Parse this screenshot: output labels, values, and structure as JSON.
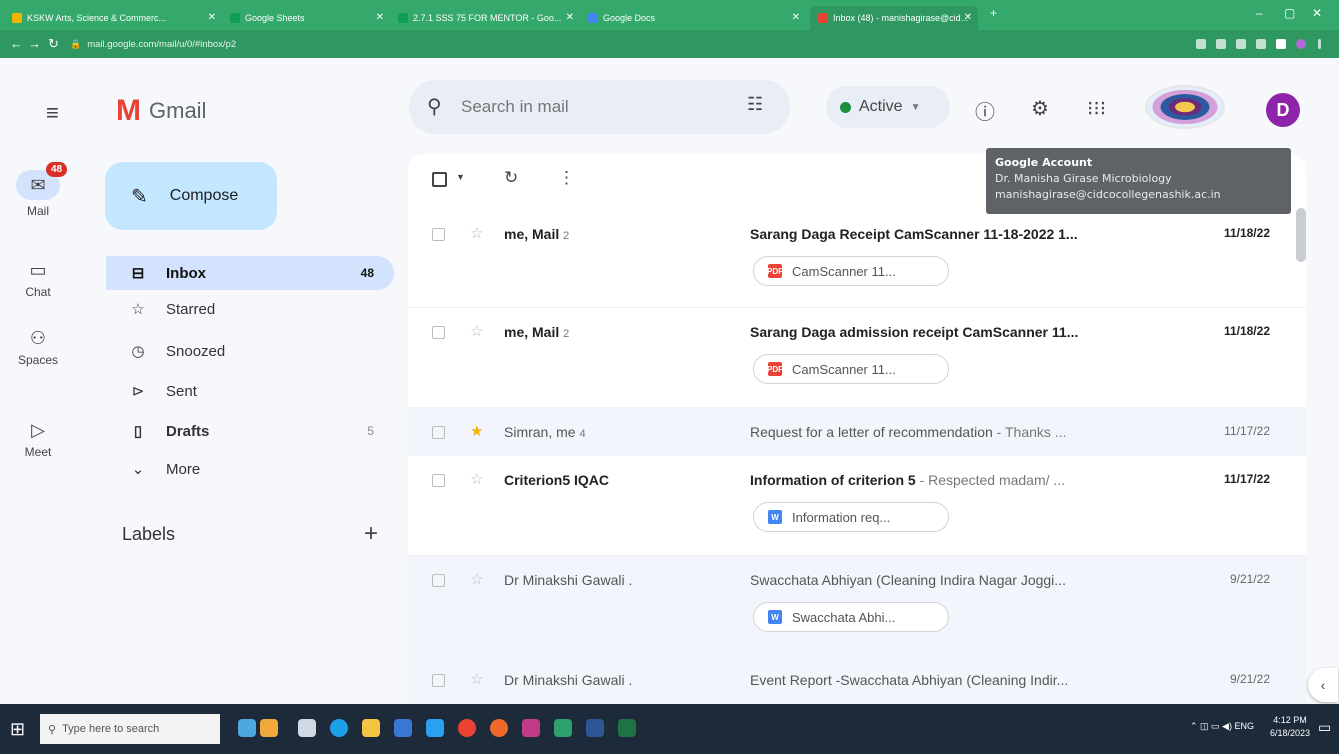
{
  "browser": {
    "tabs": [
      {
        "title": "KSKW Arts, Science & Commerc...",
        "color": "#f4b400"
      },
      {
        "title": "Google Sheets",
        "color": "#0f9d58"
      },
      {
        "title": "2.7.1 SSS 75 FOR MENTOR - Goo...",
        "color": "#0f9d58"
      },
      {
        "title": "Google Docs",
        "color": "#4285f4"
      },
      {
        "title": "Inbox (48) - manishagirase@cid...",
        "color": "#ea4335"
      }
    ],
    "url": "mail.google.com/mail/u/0/#inbox/p2"
  },
  "header": {
    "app_name": "Gmail",
    "search_placeholder": "Search in mail",
    "status_label": "Active"
  },
  "rail": {
    "mail_badge": "48",
    "items": [
      {
        "label": "Mail",
        "icon": "mail-icon"
      },
      {
        "label": "Chat",
        "icon": "chat-icon"
      },
      {
        "label": "Spaces",
        "icon": "spaces-icon"
      },
      {
        "label": "Meet",
        "icon": "meet-icon"
      }
    ]
  },
  "sidebar": {
    "compose_label": "Compose",
    "items": [
      {
        "label": "Inbox",
        "count": "48",
        "icon": "inbox-icon"
      },
      {
        "label": "Starred",
        "count": "",
        "icon": "star-icon"
      },
      {
        "label": "Snoozed",
        "count": "",
        "icon": "clock-icon"
      },
      {
        "label": "Sent",
        "count": "",
        "icon": "send-icon"
      },
      {
        "label": "Drafts",
        "count": "5",
        "icon": "draft-icon"
      },
      {
        "label": "More",
        "count": "",
        "icon": "chevron-down-icon"
      }
    ],
    "labels_title": "Labels"
  },
  "tooltip": {
    "title": "Google Account",
    "name": "Dr. Manisha Girase Microbiology",
    "email": "manishagirase@cidcocollegenashik.ac.in"
  },
  "avatar_letter": "D",
  "emails": [
    {
      "sender_pre": "me, ",
      "sender_bold": "Mail",
      "count": "2",
      "subject": "Sarang Daga Receipt CamScanner 11-18-2022 1...",
      "snippet": "",
      "date": "11/18/22",
      "unread": true,
      "starred": false,
      "attachment": "CamScanner 11...",
      "attachment_type": "pdf"
    },
    {
      "sender_pre": "me, ",
      "sender_bold": "Mail",
      "count": "2",
      "subject": "Sarang Daga admission receipt CamScanner 11...",
      "snippet": "",
      "date": "11/18/22",
      "unread": true,
      "starred": false,
      "attachment": "CamScanner 11...",
      "attachment_type": "pdf"
    },
    {
      "sender_pre": "Simran, me",
      "sender_bold": "",
      "count": "4",
      "subject": "Request for a letter of recommendation",
      "snippet": " - Thanks ...",
      "date": "11/17/22",
      "unread": false,
      "starred": true,
      "attachment": "",
      "attachment_type": ""
    },
    {
      "sender_pre": "",
      "sender_bold": "Criterion5 IQAC",
      "count": "",
      "subject": "Information of criterion 5",
      "snippet": " - Respected madam/ ...",
      "date": "11/17/22",
      "unread": true,
      "starred": false,
      "attachment": "Information req...",
      "attachment_type": "doc"
    },
    {
      "sender_pre": "Dr Minakshi Gawali .",
      "sender_bold": "",
      "count": "",
      "subject": "Swacchata Abhiyan (Cleaning Indira Nagar Joggi...",
      "snippet": "",
      "date": "9/21/22",
      "unread": false,
      "starred": false,
      "attachment": "Swacchata Abhi...",
      "attachment_type": "doc"
    },
    {
      "sender_pre": "Dr Minakshi Gawali .",
      "sender_bold": "",
      "count": "",
      "subject": "Event Report -Swacchata Abhiyan (Cleaning Indir...",
      "snippet": "",
      "date": "9/21/22",
      "unread": false,
      "starred": false,
      "attachment": "",
      "attachment_type": ""
    }
  ],
  "taskbar": {
    "search_placeholder": "Type here to search",
    "tray_lang": "ENG",
    "time": "4:12 PM",
    "date": "6/18/2023"
  }
}
